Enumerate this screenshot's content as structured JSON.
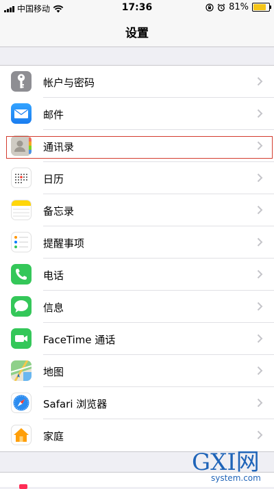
{
  "status_bar": {
    "carrier": "中国移动",
    "time": "17:36",
    "battery_percent": "81%",
    "battery_level": 0.81
  },
  "nav": {
    "title": "设置"
  },
  "settings": [
    {
      "id": "accounts",
      "label": "帐户与密码",
      "icon": "key-icon",
      "color": "#8e8e93"
    },
    {
      "id": "mail",
      "label": "邮件",
      "icon": "mail-icon",
      "color": "#1a8bf5"
    },
    {
      "id": "contacts",
      "label": "通讯录",
      "icon": "contacts-icon",
      "color": "#c9c6c0",
      "highlighted": true
    },
    {
      "id": "calendar",
      "label": "日历",
      "icon": "calendar-icon",
      "color": "#ffffff"
    },
    {
      "id": "notes",
      "label": "备忘录",
      "icon": "notes-icon",
      "color": "#ffd60a"
    },
    {
      "id": "reminders",
      "label": "提醒事项",
      "icon": "reminders-icon",
      "color": "#ffffff"
    },
    {
      "id": "phone",
      "label": "电话",
      "icon": "phone-icon",
      "color": "#34c759"
    },
    {
      "id": "messages",
      "label": "信息",
      "icon": "messages-icon",
      "color": "#34c759"
    },
    {
      "id": "facetime",
      "label": "FaceTime 通话",
      "icon": "facetime-icon",
      "color": "#34c759"
    },
    {
      "id": "maps",
      "label": "地图",
      "icon": "maps-icon",
      "color": "#6cc36a"
    },
    {
      "id": "safari",
      "label": "Safari 浏览器",
      "icon": "safari-icon",
      "color": "#1e8ef5"
    },
    {
      "id": "home",
      "label": "家庭",
      "icon": "home-icon",
      "color": "#ffffff"
    }
  ],
  "watermark": {
    "brand": "GXI网",
    "site": "system.com"
  }
}
